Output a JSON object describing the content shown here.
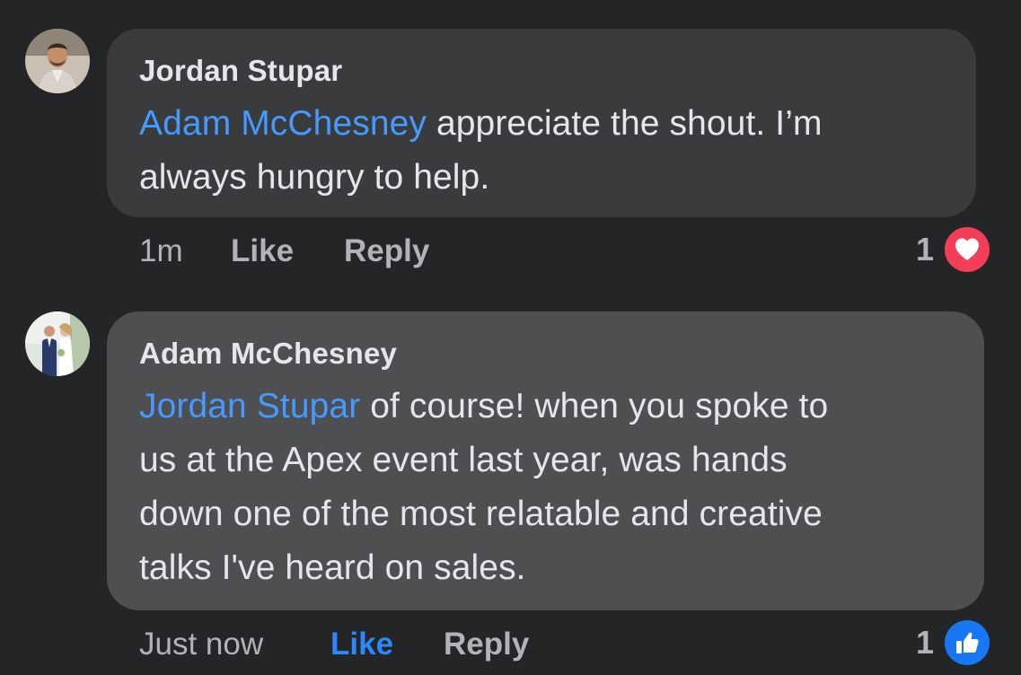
{
  "comments": [
    {
      "author": "Jordan Stupar",
      "mention": "Adam McChesney",
      "text_line1": " appreciate the shout. I’m",
      "text_line2": "always hungry to help.",
      "time": "1m",
      "like_label": "Like",
      "reply_label": "Reply",
      "reaction_count": "1",
      "reaction_type": "love-icon",
      "reaction_color": "#f33e58",
      "liked_by_viewer": false
    },
    {
      "author": "Adam McChesney",
      "mention": "Jordan Stupar",
      "text_line1": " of course! when you spoke to",
      "text_line2": "us at the Apex event last year, was hands",
      "text_line3": "down one of the most relatable and creative",
      "text_line4": "talks I've heard on sales.",
      "time": "Just now",
      "like_label": "Like",
      "reply_label": "Reply",
      "reaction_count": "1",
      "reaction_type": "like-icon",
      "reaction_color": "#1877f2",
      "liked_by_viewer": true
    }
  ],
  "colors": {
    "background": "#242526",
    "bubble_default": "#3a3b3c",
    "bubble_highlight": "#4e4f50",
    "mention": "#4599ff",
    "like_active": "#2d88ff",
    "secondary_text": "#b0b3b8"
  }
}
